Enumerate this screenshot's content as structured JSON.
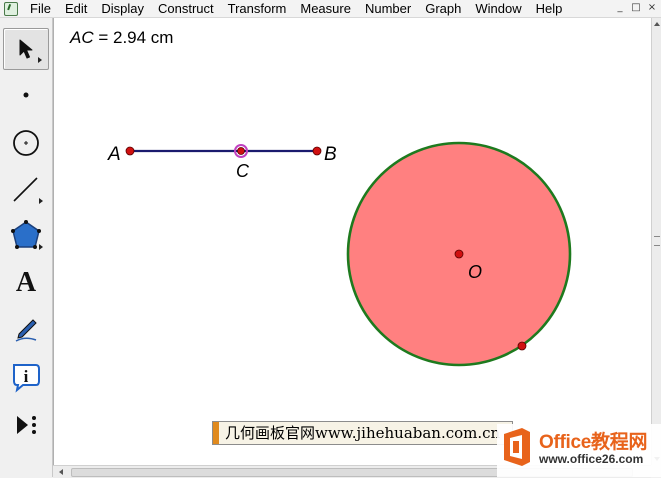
{
  "menu": {
    "items": [
      "File",
      "Edit",
      "Display",
      "Construct",
      "Transform",
      "Measure",
      "Number",
      "Graph",
      "Window",
      "Help"
    ],
    "window_controls": [
      "_",
      "□",
      "×"
    ]
  },
  "toolbox": {
    "tools": [
      {
        "name": "selection-arrow-tool",
        "icon": "arrow-icon"
      },
      {
        "name": "point-tool",
        "icon": "point-icon"
      },
      {
        "name": "compass-tool",
        "icon": "compass-circle-icon"
      },
      {
        "name": "straightedge-tool",
        "icon": "line-segment-icon"
      },
      {
        "name": "polygon-tool",
        "icon": "pentagon-icon"
      },
      {
        "name": "text-tool",
        "icon": "text-a-icon",
        "glyph": "A"
      },
      {
        "name": "marker-tool",
        "icon": "pen-icon"
      },
      {
        "name": "information-tool",
        "icon": "info-icon",
        "glyph": "i"
      },
      {
        "name": "custom-tool",
        "icon": "custom-tools-icon"
      }
    ]
  },
  "canvas": {
    "measurement": {
      "variable": "AC",
      "equals": " = ",
      "value": "2.94 cm"
    },
    "labels": {
      "A": "A",
      "B": "B",
      "C": "C",
      "O": "O"
    },
    "colors": {
      "segment": "#1a1a6e",
      "point": "#d01010",
      "circle_fill": "#ff8080",
      "circle_stroke": "#1e7a1e",
      "selected_point_ring": "#c040c0"
    }
  },
  "watermark": {
    "text": "几何画板官网www.jihehuaban.com.cn"
  },
  "office_logo": {
    "line1": "Office教程网",
    "line2": "www.office26.com"
  }
}
